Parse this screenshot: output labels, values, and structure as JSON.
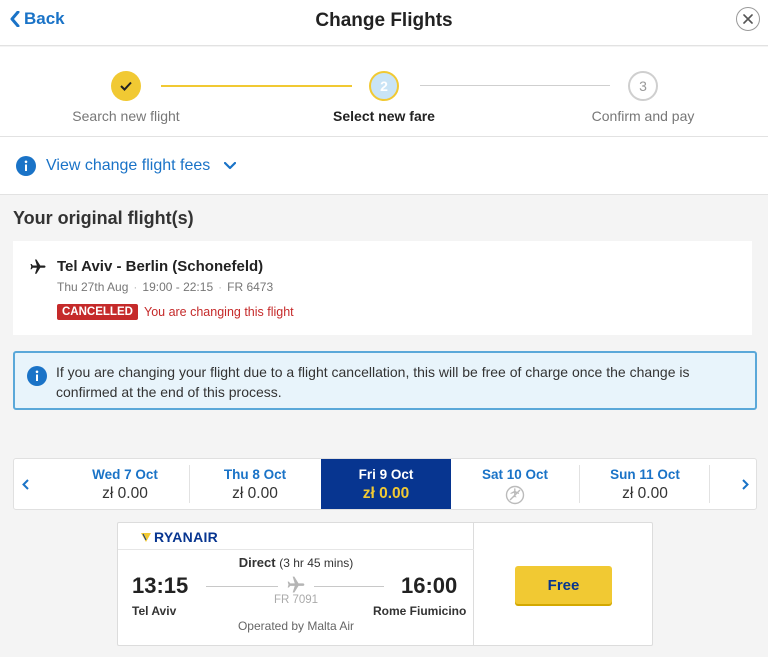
{
  "header": {
    "back_label": "Back",
    "title": "Change Flights"
  },
  "stepper": {
    "steps": [
      {
        "number": "",
        "label": "Search new flight",
        "state": "done"
      },
      {
        "number": "2",
        "label": "Select new fare",
        "state": "active"
      },
      {
        "number": "3",
        "label": "Confirm and pay",
        "state": "pending"
      }
    ]
  },
  "fees": {
    "label": "View change flight fees"
  },
  "original": {
    "section_title": "Your original flight(s)",
    "route": "Tel Aviv - Berlin (Schonefeld)",
    "date": "Thu 27th Aug",
    "times": "19:00 - 22:15",
    "flight_number": "FR 6473",
    "status_badge": "CANCELLED",
    "status_note": "You are changing this flight"
  },
  "info": {
    "text": "If you are changing your flight due to a flight cancellation, this will be free of charge once the change is confirmed at the end of this process."
  },
  "dates": [
    {
      "day": "Wed 7 Oct",
      "price": "zł 0.00",
      "selected": false
    },
    {
      "day": "Thu 8 Oct",
      "price": "zł 0.00",
      "selected": false
    },
    {
      "day": "Fri 9 Oct",
      "price": "zł 0.00",
      "selected": true
    },
    {
      "day": "Sat 10 Oct",
      "price": "",
      "selected": false,
      "no_flights": true
    },
    {
      "day": "Sun 11 Oct",
      "price": "zł 0.00",
      "selected": false
    }
  ],
  "fare": {
    "airline": "RYANAIR",
    "direct": "Direct",
    "duration": "(3 hr 45 mins)",
    "depart_time": "13:15",
    "depart_city": "Tel Aviv",
    "arrive_time": "16:00",
    "arrive_city": "Rome Fiumicino",
    "flight_number": "FR 7091",
    "operated_by": "Operated by Malta Air",
    "button_label": "Free"
  },
  "colors": {
    "brand_blue": "#073590",
    "link_blue": "#1a73c7",
    "yellow": "#f1c933",
    "cancel_red": "#c52a2a"
  }
}
